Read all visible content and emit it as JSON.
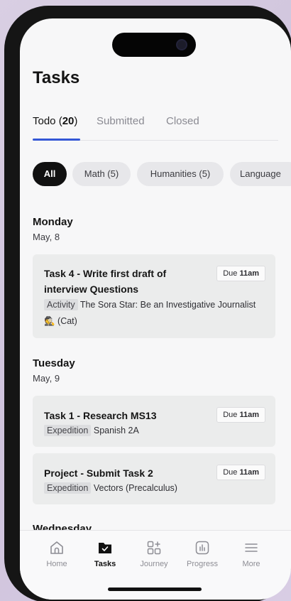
{
  "header": {
    "title": "Tasks"
  },
  "tabs": [
    {
      "label": "Todo",
      "count": "20",
      "open": "(",
      "close": ")"
    },
    {
      "label": "Submitted"
    },
    {
      "label": "Closed"
    }
  ],
  "filters": [
    {
      "label": "All"
    },
    {
      "label": "Math (5)"
    },
    {
      "label": "Humanities (5)"
    },
    {
      "label": "Language"
    }
  ],
  "days": [
    {
      "day": "Monday",
      "date": "May, 8",
      "tasks": [
        {
          "title": "Task 4 - Write first draft of interview Questions",
          "due_prefix": "Due",
          "due_time": "11am",
          "tag": "Activity",
          "course": "The Sora Star: Be an Investigative Journalist 🕵️ (Cat)"
        }
      ]
    },
    {
      "day": "Tuesday",
      "date": "May, 9",
      "tasks": [
        {
          "title": "Task 1 - Research MS13",
          "due_prefix": "Due",
          "due_time": "11am",
          "tag": "Expedition",
          "course": "Spanish 2A"
        },
        {
          "title": "Project - Submit Task 2",
          "due_prefix": "Due",
          "due_time": "11am",
          "tag": "Expedition",
          "course": "Vectors (Precalculus)"
        }
      ]
    },
    {
      "day": "Wednesday"
    }
  ],
  "nav": [
    {
      "label": "Home",
      "icon": "home-icon"
    },
    {
      "label": "Tasks",
      "icon": "tasks-folder-icon"
    },
    {
      "label": "Journey",
      "icon": "journey-grid-icon"
    },
    {
      "label": "Progress",
      "icon": "progress-chart-icon"
    },
    {
      "label": "More",
      "icon": "menu-icon"
    }
  ],
  "colors": {
    "accent": "#3457d6",
    "active_chip": "#111111",
    "card_bg": "#ebecec"
  }
}
